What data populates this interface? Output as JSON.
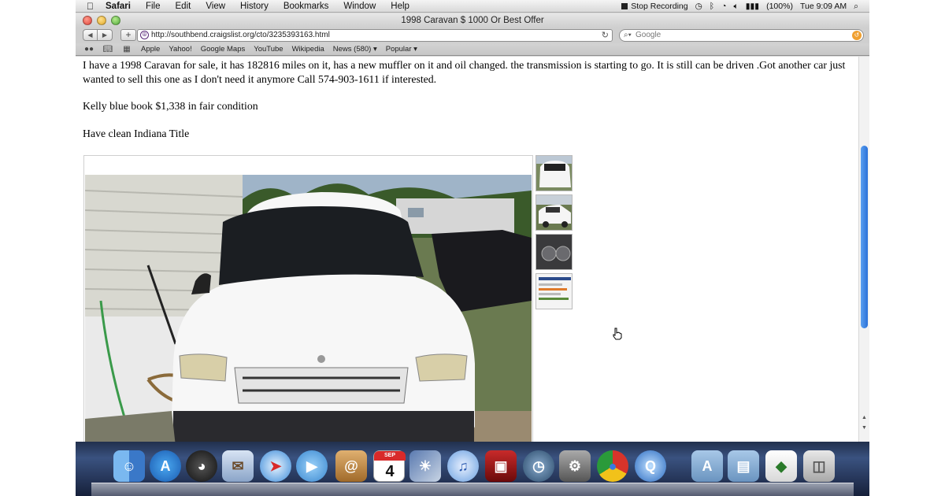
{
  "menubar": {
    "app": "Safari",
    "items": [
      "File",
      "Edit",
      "View",
      "History",
      "Bookmarks",
      "Window",
      "Help"
    ],
    "status": {
      "recording": "Stop Recording",
      "battery": "(100%)",
      "clock": "Tue 9:09 AM"
    }
  },
  "window": {
    "title": "1998 Caravan $ 1000 Or Best Offer"
  },
  "toolbar": {
    "url": "http://southbend.craigslist.org/cto/3235393163.html",
    "search_placeholder": "Google"
  },
  "bookmarks": {
    "items": [
      "Apple",
      "Yahoo!",
      "Google Maps",
      "YouTube",
      "Wikipedia",
      "News (580) ▾",
      "Popular ▾"
    ]
  },
  "post": {
    "description": "I have a 1998 Caravan for sale, it has 182816 miles on it, has a new muffler on it and oil changed. the transmission is starting to go. It is still can be driven .Got another car just wanted to sell this one as I don't need it anymore Call 574-903-1611 if interested.",
    "kbb": "Kelly blue book $1,338 in fair condition",
    "title_note": "Have clean Indiana Title"
  },
  "dock": {
    "calendar_month": "SEP",
    "calendar_day": "4",
    "icons": [
      "finder-icon",
      "app-store-icon",
      "dashboard-icon",
      "mail-icon",
      "safari-icon",
      "facetime-icon",
      "address-book-icon",
      "calendar-icon",
      "iphoto-icon",
      "itunes-icon",
      "photo-booth-icon",
      "time-machine-icon",
      "system-preferences-icon",
      "chrome-icon",
      "quicktime-icon",
      "applications-folder-icon",
      "documents-folder-icon",
      "downloads-stack-icon",
      "trash-icon"
    ]
  },
  "colors": {
    "scroll_thumb": "#2a70d8",
    "dock_bg": "#21304d",
    "van": "#ffffff",
    "siding": "#d8d8d0"
  }
}
